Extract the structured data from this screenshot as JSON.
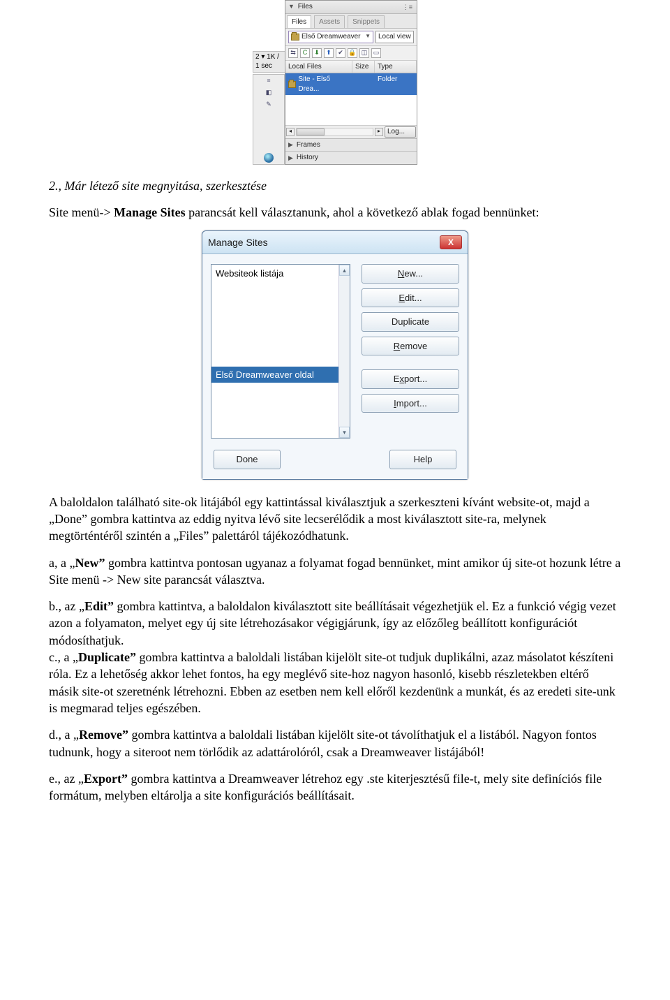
{
  "files_panel": {
    "title": "Files",
    "tabs": [
      "Files",
      "Assets",
      "Snippets"
    ],
    "site_combo": "Első Dreamweaver",
    "view_combo": "Local view",
    "columns": {
      "files": "Local Files",
      "size": "Size",
      "type": "Type"
    },
    "row": {
      "name": "Site - Első Drea...",
      "type_value": "Folder"
    },
    "log_button": "Log...",
    "collapsed": [
      "Frames",
      "History"
    ],
    "status": "2 ▾   1K / 1 sec"
  },
  "heading": "2., Már létező site megnyitása, szerkesztése",
  "intro_before_bold": "Site menü-> ",
  "intro_bold": "Manage Sites",
  "intro_after_bold": " parancsát kell választanunk, ahol a következő ablak fogad bennünket:",
  "dialog": {
    "title": "Manage Sites",
    "list_plain": "Websiteok listája",
    "list_selected": "Első Dreamweaver oldal",
    "buttons": {
      "new": "New...",
      "edit": "Edit...",
      "duplicate": "Duplicate",
      "remove": "Remove",
      "export": "Export...",
      "import": "Import..."
    },
    "done": "Done",
    "help": "Help"
  },
  "p_after_dialog": "A baloldalon található site-ok litájából egy kattintással kiválasztjuk a szerkeszteni kívánt website-ot, majd a „Done” gombra kattintva az eddig nyitva lévő site lecserélődik a most kiválasztott site-ra, melynek megtörténtéről szintén a „Files” palettáról tájékozódhatunk.",
  "p_a_prefix": "a, a „",
  "p_a_bold": "New”",
  "p_a_rest": " gombra kattintva pontosan ugyanaz a folyamat fogad bennünket, mint amikor új site-ot hozunk létre a Site menü -> New site parancsát választva.",
  "p_b_prefix": "b., az „",
  "p_b_bold": "Edit”",
  "p_b_rest": " gombra kattintva, a baloldalon kiválasztott site beállításait végezhetjük el. Ez a funkció végig vezet azon a folyamaton, melyet egy új site létrehozásakor végigjárunk, így az előzőleg beállított konfigurációt módosíthatjuk.",
  "p_c_prefix": "c., a „",
  "p_c_bold": "Duplicate”",
  "p_c_rest": " gombra kattintva a baloldali listában kijelölt site-ot tudjuk duplikálni, azaz másolatot készíteni róla. Ez a lehetőség akkor lehet fontos, ha egy meglévő site-hoz nagyon hasonló, kisebb részletekben eltérő másik site-ot szeretnénk létrehozni. Ebben az esetben nem kell előről kezdenünk a munkát, és az eredeti site-unk is megmarad teljes egészében.",
  "p_d_prefix": "d., a „",
  "p_d_bold": "Remove”",
  "p_d_rest": " gombra kattintva a baloldali listában kijelölt site-ot távolíthatjuk el a listából. Nagyon fontos tudnunk, hogy a siteroot nem törlődik az adattárolóról, csak a Dreamweaver listájából!",
  "p_e_prefix": "e., az „",
  "p_e_bold": "Export”",
  "p_e_rest": " gombra kattintva a Dreamweaver létrehoz egy .ste kiterjesztésű file-t, mely site definíciós file formátum, melyben eltárolja a site konfigurációs beállításait."
}
